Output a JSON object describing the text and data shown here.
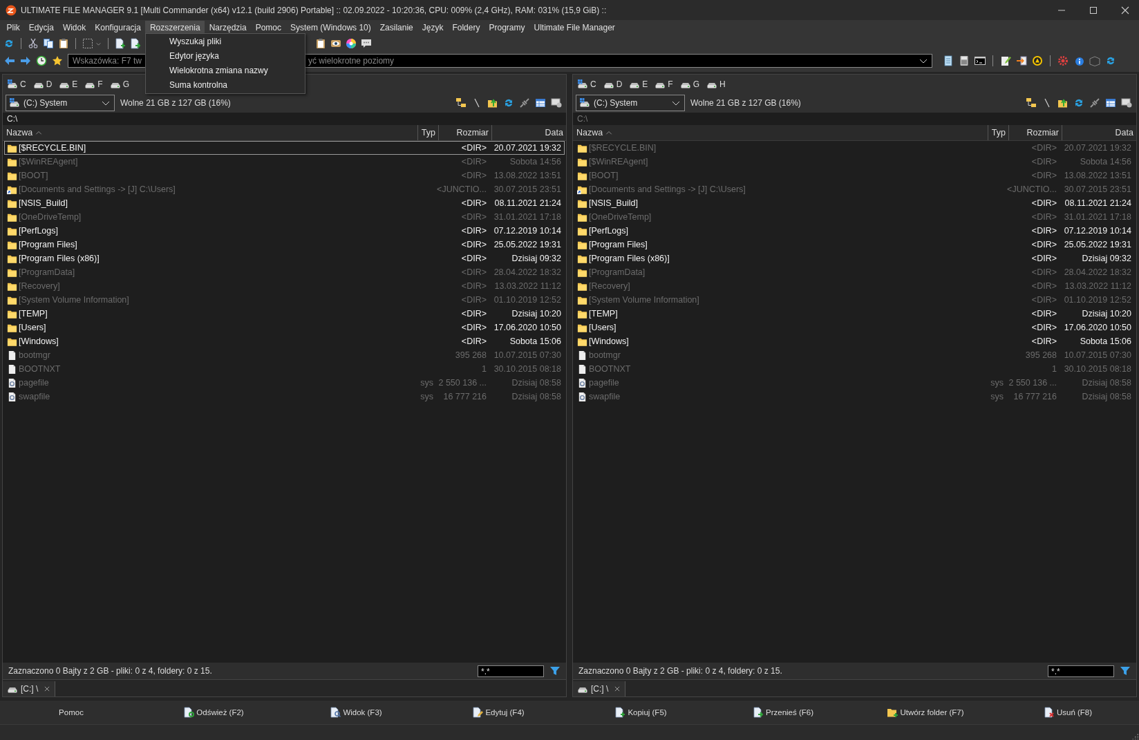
{
  "window": {
    "title": "ULTIMATE FILE MANAGER 9.1 [Multi Commander (x64)  v12.1 (build 2906) Portable] :: 02.09.2022 - 10:20:36, CPU: 009% (2,4 GHz), RAM: 031% (15,9 GiB) ::"
  },
  "menu": [
    {
      "label": "Plik",
      "selected": false
    },
    {
      "label": "Edycja",
      "selected": false
    },
    {
      "label": "Widok",
      "selected": false
    },
    {
      "label": "Konfiguracja",
      "selected": false
    },
    {
      "label": "Rozszerzenia",
      "selected": true
    },
    {
      "label": "Narzędzia",
      "selected": false
    },
    {
      "label": "Pomoc",
      "selected": false
    },
    {
      "label": "System (Windows 10)",
      "selected": false
    },
    {
      "label": "Zasilanie",
      "selected": false
    },
    {
      "label": "Język",
      "selected": false
    },
    {
      "label": "Foldery",
      "selected": false
    },
    {
      "label": "Programy",
      "selected": false
    },
    {
      "label": "Ultimate File Manager",
      "selected": false
    }
  ],
  "open_menu": {
    "items": [
      "Wyszukaj pliki",
      "Edytor języka",
      "Wielokrotna zmiana nazwy",
      "Suma kontrolna"
    ]
  },
  "address_bar": {
    "hint_start": "Wskazówka: F7 tw",
    "hint_end": "yć wielokrotne poziomy"
  },
  "panels": [
    {
      "active": true,
      "drives": [
        {
          "letter": "C",
          "kind": "system"
        },
        {
          "letter": "D",
          "kind": "disk"
        },
        {
          "letter": "E",
          "kind": "disk"
        },
        {
          "letter": "F",
          "kind": "disk"
        },
        {
          "letter": "G",
          "kind": "disk"
        }
      ],
      "drive_select": "(C:) System",
      "free_space": "Wolne 21 GB z 127 GB (16%)",
      "path": "C:\\",
      "columns": [
        "Nazwa",
        "Typ",
        "Rozmiar",
        "Data"
      ],
      "rows": [
        {
          "name": "[$RECYCLE.BIN]",
          "type": "",
          "size": "<DIR>",
          "date": "20.07.2021 19:32",
          "kind": "dir",
          "hidden": false,
          "selected": true
        },
        {
          "name": "[$WinREAgent]",
          "type": "",
          "size": "<DIR>",
          "date": "Sobota 14:56",
          "kind": "dir",
          "hidden": true,
          "selected": false
        },
        {
          "name": "[BOOT]",
          "type": "",
          "size": "<DIR>",
          "date": "13.08.2022 13:51",
          "kind": "dir",
          "hidden": true,
          "selected": false
        },
        {
          "name": "[Documents and Settings ->  [J] C:\\Users]",
          "type": "",
          "size": "<JUNCTIO...",
          "date": "30.07.2015 23:51",
          "kind": "junction",
          "hidden": true,
          "selected": false
        },
        {
          "name": "[NSIS_Build]",
          "type": "",
          "size": "<DIR>",
          "date": "08.11.2021 21:24",
          "kind": "dir",
          "hidden": false,
          "selected": false
        },
        {
          "name": "[OneDriveTemp]",
          "type": "",
          "size": "<DIR>",
          "date": "31.01.2021 17:18",
          "kind": "dir",
          "hidden": true,
          "selected": false
        },
        {
          "name": "[PerfLogs]",
          "type": "",
          "size": "<DIR>",
          "date": "07.12.2019 10:14",
          "kind": "dir",
          "hidden": false,
          "selected": false
        },
        {
          "name": "[Program Files]",
          "type": "",
          "size": "<DIR>",
          "date": "25.05.2022 19:31",
          "kind": "dir",
          "hidden": false,
          "selected": false
        },
        {
          "name": "[Program Files (x86)]",
          "type": "",
          "size": "<DIR>",
          "date": "Dzisiaj 09:32",
          "kind": "dir",
          "hidden": false,
          "selected": false
        },
        {
          "name": "[ProgramData]",
          "type": "",
          "size": "<DIR>",
          "date": "28.04.2022 18:32",
          "kind": "dir",
          "hidden": true,
          "selected": false
        },
        {
          "name": "[Recovery]",
          "type": "",
          "size": "<DIR>",
          "date": "13.03.2022 11:12",
          "kind": "dir",
          "hidden": true,
          "selected": false
        },
        {
          "name": "[System Volume Information]",
          "type": "",
          "size": "<DIR>",
          "date": "01.10.2019 12:52",
          "kind": "dir",
          "hidden": true,
          "selected": false
        },
        {
          "name": "[TEMP]",
          "type": "",
          "size": "<DIR>",
          "date": "Dzisiaj 10:20",
          "kind": "dir",
          "hidden": false,
          "selected": false
        },
        {
          "name": "[Users]",
          "type": "",
          "size": "<DIR>",
          "date": "17.06.2020 10:50",
          "kind": "dir",
          "hidden": false,
          "selected": false
        },
        {
          "name": "[Windows]",
          "type": "",
          "size": "<DIR>",
          "date": "Sobota 15:06",
          "kind": "dir",
          "hidden": false,
          "selected": false
        },
        {
          "name": "bootmgr",
          "type": "",
          "size": "395 268",
          "date": "10.07.2015 07:30",
          "kind": "file",
          "hidden": true,
          "selected": false
        },
        {
          "name": "BOOTNXT",
          "type": "",
          "size": "1",
          "date": "30.10.2015 08:18",
          "kind": "file",
          "hidden": true,
          "selected": false
        },
        {
          "name": "pagefile",
          "type": "sys",
          "size": "2 550 136 ...",
          "date": "Dzisiaj 08:58",
          "kind": "system",
          "hidden": true,
          "selected": false
        },
        {
          "name": "swapfile",
          "type": "sys",
          "size": "16 777 216",
          "date": "Dzisiaj 08:58",
          "kind": "system",
          "hidden": true,
          "selected": false
        }
      ],
      "status": "Zaznaczono 0 Bajty z 2 GB - pliki: 0 z 4, foldery: 0 z 15.",
      "filter": "*.*",
      "tabs": [
        {
          "label": "[C:] \\",
          "selected": true
        }
      ]
    },
    {
      "active": false,
      "drives": [
        {
          "letter": "C",
          "kind": "system"
        },
        {
          "letter": "D",
          "kind": "disk"
        },
        {
          "letter": "E",
          "kind": "disk"
        },
        {
          "letter": "F",
          "kind": "disk"
        },
        {
          "letter": "G",
          "kind": "disk"
        },
        {
          "letter": "H",
          "kind": "disk"
        }
      ],
      "drive_select": "(C:) System",
      "free_space": "Wolne 21 GB z 127 GB (16%)",
      "path": "C:\\",
      "columns": [
        "Nazwa",
        "Typ",
        "Rozmiar",
        "Data"
      ],
      "rows": [
        {
          "name": "[$RECYCLE.BIN]",
          "type": "",
          "size": "<DIR>",
          "date": "20.07.2021 19:32",
          "kind": "dir",
          "hidden": true,
          "selected": false
        },
        {
          "name": "[$WinREAgent]",
          "type": "",
          "size": "<DIR>",
          "date": "Sobota 14:56",
          "kind": "dir",
          "hidden": true,
          "selected": false
        },
        {
          "name": "[BOOT]",
          "type": "",
          "size": "<DIR>",
          "date": "13.08.2022 13:51",
          "kind": "dir",
          "hidden": true,
          "selected": false
        },
        {
          "name": "[Documents and Settings ->  [J] C:\\Users]",
          "type": "",
          "size": "<JUNCTIO...",
          "date": "30.07.2015 23:51",
          "kind": "junction",
          "hidden": true,
          "selected": false
        },
        {
          "name": "[NSIS_Build]",
          "type": "",
          "size": "<DIR>",
          "date": "08.11.2021 21:24",
          "kind": "dir",
          "hidden": false,
          "selected": false
        },
        {
          "name": "[OneDriveTemp]",
          "type": "",
          "size": "<DIR>",
          "date": "31.01.2021 17:18",
          "kind": "dir",
          "hidden": true,
          "selected": false
        },
        {
          "name": "[PerfLogs]",
          "type": "",
          "size": "<DIR>",
          "date": "07.12.2019 10:14",
          "kind": "dir",
          "hidden": false,
          "selected": false
        },
        {
          "name": "[Program Files]",
          "type": "",
          "size": "<DIR>",
          "date": "25.05.2022 19:31",
          "kind": "dir",
          "hidden": false,
          "selected": false
        },
        {
          "name": "[Program Files (x86)]",
          "type": "",
          "size": "<DIR>",
          "date": "Dzisiaj 09:32",
          "kind": "dir",
          "hidden": false,
          "selected": false
        },
        {
          "name": "[ProgramData]",
          "type": "",
          "size": "<DIR>",
          "date": "28.04.2022 18:32",
          "kind": "dir",
          "hidden": true,
          "selected": false
        },
        {
          "name": "[Recovery]",
          "type": "",
          "size": "<DIR>",
          "date": "13.03.2022 11:12",
          "kind": "dir",
          "hidden": true,
          "selected": false
        },
        {
          "name": "[System Volume Information]",
          "type": "",
          "size": "<DIR>",
          "date": "01.10.2019 12:52",
          "kind": "dir",
          "hidden": true,
          "selected": false
        },
        {
          "name": "[TEMP]",
          "type": "",
          "size": "<DIR>",
          "date": "Dzisiaj 10:20",
          "kind": "dir",
          "hidden": false,
          "selected": false
        },
        {
          "name": "[Users]",
          "type": "",
          "size": "<DIR>",
          "date": "17.06.2020 10:50",
          "kind": "dir",
          "hidden": false,
          "selected": false
        },
        {
          "name": "[Windows]",
          "type": "",
          "size": "<DIR>",
          "date": "Sobota 15:06",
          "kind": "dir",
          "hidden": false,
          "selected": false
        },
        {
          "name": "bootmgr",
          "type": "",
          "size": "395 268",
          "date": "10.07.2015 07:30",
          "kind": "file",
          "hidden": true,
          "selected": false
        },
        {
          "name": "BOOTNXT",
          "type": "",
          "size": "1",
          "date": "30.10.2015 08:18",
          "kind": "file",
          "hidden": true,
          "selected": false
        },
        {
          "name": "pagefile",
          "type": "sys",
          "size": "2 550 136 ...",
          "date": "Dzisiaj 08:58",
          "kind": "system",
          "hidden": true,
          "selected": false
        },
        {
          "name": "swapfile",
          "type": "sys",
          "size": "16 777 216",
          "date": "Dzisiaj 08:58",
          "kind": "system",
          "hidden": true,
          "selected": false
        }
      ],
      "status": "Zaznaczono 0 Bajty z 2 GB - pliki: 0 z 4, foldery: 0 z 15.",
      "filter": "*.*",
      "tabs": [
        {
          "label": "[C:] \\",
          "selected": true
        }
      ]
    }
  ],
  "function_keys": [
    {
      "label": "Pomoc"
    },
    {
      "label": "Odśwież (F2)"
    },
    {
      "label": "Widok (F3)"
    },
    {
      "label": "Edytuj (F4)"
    },
    {
      "label": "Kopiuj (F5)"
    },
    {
      "label": "Przenieś (F6)"
    },
    {
      "label": "Utwórz folder (F7)"
    },
    {
      "label": "Usuń (F8)"
    }
  ]
}
